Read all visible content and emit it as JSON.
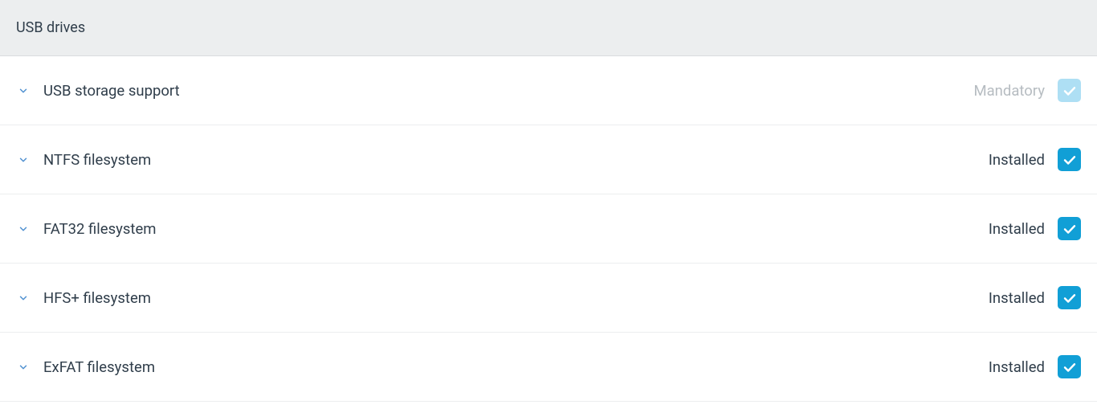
{
  "section": {
    "title": "USB drives",
    "items": [
      {
        "label": "USB storage support",
        "status": "Mandatory",
        "status_class": "mandatory",
        "check_class": "mandatory"
      },
      {
        "label": "NTFS filesystem",
        "status": "Installed",
        "status_class": "",
        "check_class": "enabled"
      },
      {
        "label": "FAT32 filesystem",
        "status": "Installed",
        "status_class": "",
        "check_class": "enabled"
      },
      {
        "label": "HFS+ filesystem",
        "status": "Installed",
        "status_class": "",
        "check_class": "enabled"
      },
      {
        "label": "ExFAT filesystem",
        "status": "Installed",
        "status_class": "",
        "check_class": "enabled"
      }
    ]
  },
  "colors": {
    "chevron": "#4f90d0",
    "check_stroke": "#ffffff"
  }
}
